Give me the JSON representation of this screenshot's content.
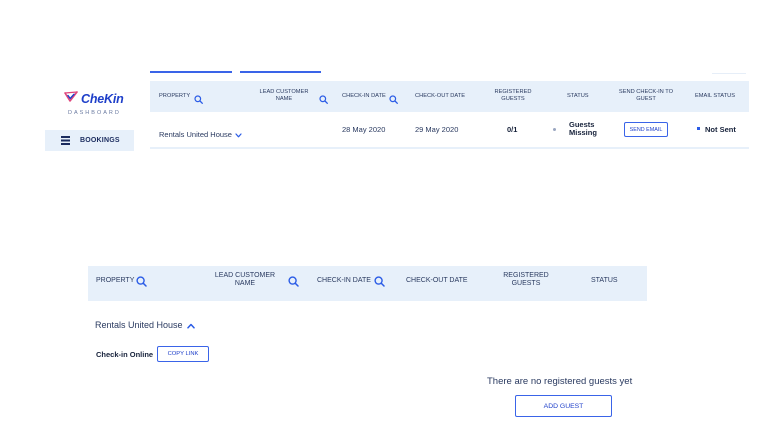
{
  "top": {
    "brand": "CheKin",
    "brand_sub": "DASHBOARD",
    "sidebar_bookings": "BOOKINGS",
    "headers": {
      "property": "PROPERTY",
      "lead_customer": "LEAD CUSTOMER NAME",
      "check_in": "CHECK-IN DATE",
      "check_out": "CHECK-OUT DATE",
      "registered": "REGISTERED GUESTS",
      "status": "STATUS",
      "send_checkin": "SEND CHECK-IN TO GUEST",
      "email_status": "EMAIL STATUS"
    },
    "row": {
      "property": "Rentals United House",
      "check_in": "28 May 2020",
      "check_out": "29 May 2020",
      "registered": "0/1",
      "status": "Guests Missing",
      "send_button": "SEND EMAIL",
      "email_status": "Not Sent"
    }
  },
  "bottom": {
    "headers": {
      "property": "PROPERTY",
      "lead_customer": "LEAD CUSTOMER NAME",
      "check_in": "CHECK-IN DATE",
      "check_out": "CHECK-OUT DATE",
      "registered": "REGISTERED GUESTS",
      "status": "STATUS"
    },
    "property_name": "Rentals United House",
    "checkin_online_label": "Check-in Online",
    "copy_link_button": "COPY LINK",
    "empty_message": "There are no registered guests yet",
    "add_guest_button": "ADD GUEST"
  },
  "colors": {
    "accent": "#3a64e8",
    "brand": "#1e3fc9",
    "header_bg": "#e7f0fa"
  },
  "icons": [
    "logo-check-icon",
    "bookings-list-icon",
    "search-icon",
    "chevron-down-icon",
    "chevron-up-icon",
    "status-dot-icon",
    "email-status-dot-icon"
  ]
}
